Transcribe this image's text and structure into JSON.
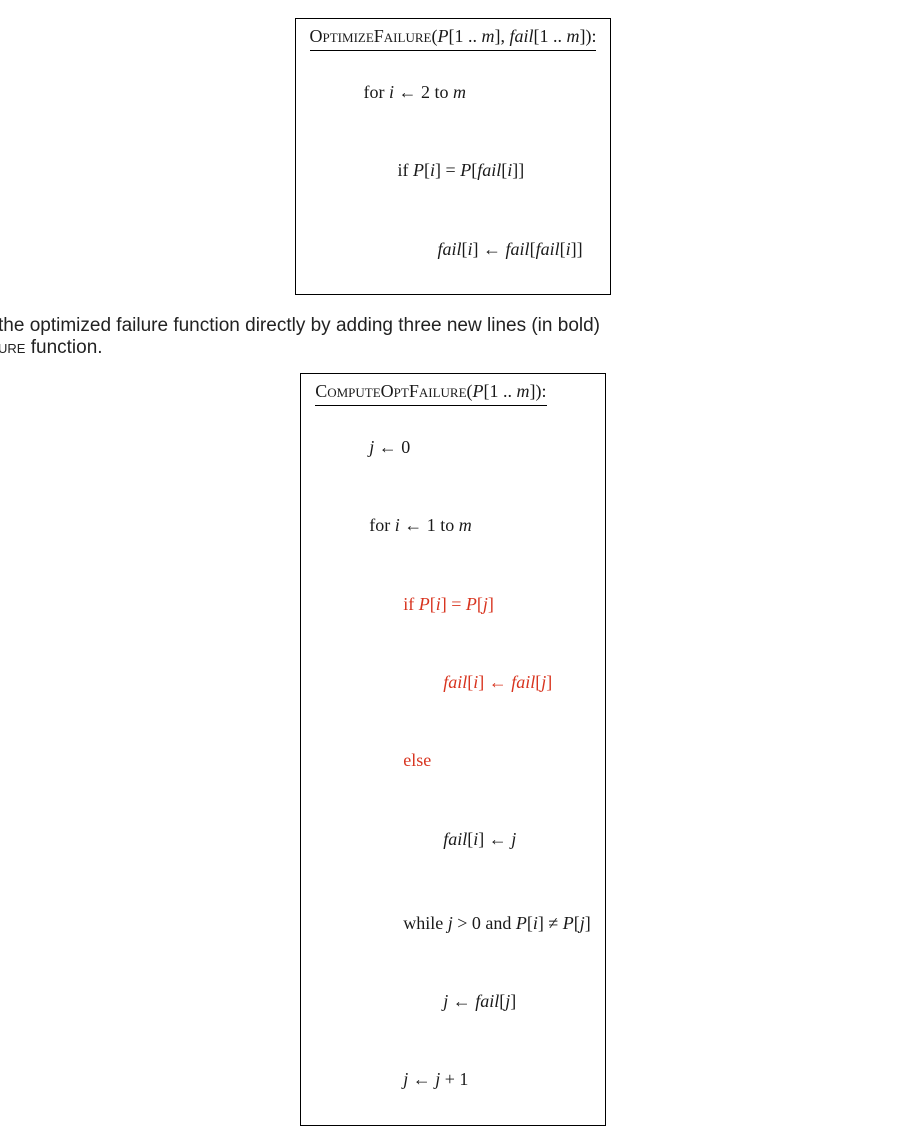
{
  "algo1": {
    "name_sc": "OptimizeFailure",
    "params_open": "(",
    "params_P": "P",
    "params_r1": "[1 .. ",
    "params_m1": "m",
    "params_r1b": "], ",
    "params_fail": "fail",
    "params_r2": "[1 .. ",
    "params_m2": "m",
    "params_r2b": "]):",
    "l1_a": "for ",
    "l1_b": "i",
    "l1_c": " ← 2 to ",
    "l1_d": "m",
    "l2_a": "if ",
    "l2_b": "P",
    "l2_c": "[",
    "l2_d": "i",
    "l2_e": "] = ",
    "l2_f": "P",
    "l2_g": "[",
    "l2_h": "fail",
    "l2_i": "[",
    "l2_j": "i",
    "l2_k": "]]",
    "l3_a": "fail",
    "l3_b": "[",
    "l3_c": "i",
    "l3_d": "] ← ",
    "l3_e": "fail",
    "l3_f": "[",
    "l3_g": "fail",
    "l3_h": "[",
    "l3_i": "i",
    "l3_j": "]]"
  },
  "prose": {
    "frag1": " the optimized failure function directly by adding three new lines (in bold)",
    "frag2_sc": "ure",
    "frag2_rest": " function."
  },
  "algo2": {
    "name_sc": "ComputeOptFailure",
    "params_open": "(",
    "params_P": "P",
    "params_r1": "[1 .. ",
    "params_m1": "m",
    "params_r1b": "]):",
    "l1_a": "j",
    "l1_b": " ← 0",
    "l2_a": "for ",
    "l2_b": "i",
    "l2_c": " ← 1 to ",
    "l2_d": "m",
    "l3_a": "if ",
    "l3_b": "P",
    "l3_c": "[",
    "l3_d": "i",
    "l3_e": "] = ",
    "l3_f": "P",
    "l3_g": "[",
    "l3_h": "j",
    "l3_i": "]",
    "l4_a": "fail",
    "l4_b": "[",
    "l4_c": "i",
    "l4_d": "] ← ",
    "l4_e": "fail",
    "l4_f": "[",
    "l4_g": "j",
    "l4_h": "]",
    "l5_a": "else",
    "l6_a": "fail",
    "l6_b": "[",
    "l6_c": "i",
    "l6_d": "] ← ",
    "l6_e": "j",
    "l7_a": "while ",
    "l7_b": "j",
    "l7_c": " > 0 and ",
    "l7_d": "P",
    "l7_e": "[",
    "l7_f": "i",
    "l7_g": "] ≠ ",
    "l7_h": "P",
    "l7_i": "[",
    "l7_j": "j",
    "l7_k": "]",
    "l8_a": "j",
    "l8_b": " ← ",
    "l8_c": "fail",
    "l8_d": "[",
    "l8_e": "j",
    "l8_f": "]",
    "l9_a": "j",
    "l9_b": " ← ",
    "l9_c": "j",
    "l9_d": " + 1"
  }
}
